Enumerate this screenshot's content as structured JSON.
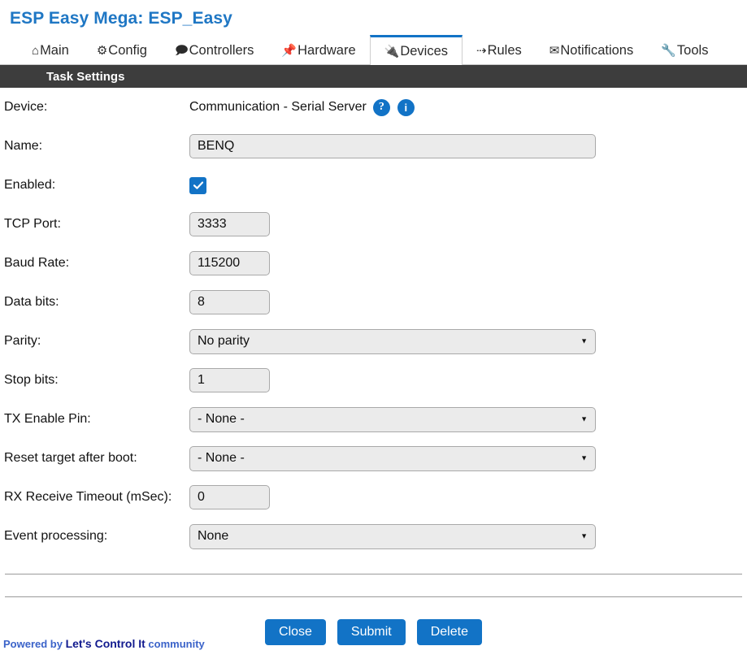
{
  "header": {
    "title": "ESP Easy Mega: ESP_Easy"
  },
  "tabs": [
    {
      "label": "Main",
      "icon": "home-icon",
      "glyph": "⌂",
      "active": false
    },
    {
      "label": "Config",
      "icon": "gear-icon",
      "glyph": "⚙",
      "active": false
    },
    {
      "label": "Controllers",
      "icon": "speech-bubble-icon",
      "glyph": "🗩",
      "active": false
    },
    {
      "label": "Hardware",
      "icon": "pushpin-icon",
      "glyph": "📌",
      "active": false
    },
    {
      "label": "Devices",
      "icon": "plug-icon",
      "glyph": "🔌",
      "active": true
    },
    {
      "label": "Rules",
      "icon": "arrow-branch-icon",
      "glyph": "⇢",
      "active": false
    },
    {
      "label": "Notifications",
      "icon": "envelope-icon",
      "glyph": "✉",
      "active": false
    },
    {
      "label": "Tools",
      "icon": "wrench-icon",
      "glyph": "🔧",
      "active": false
    }
  ],
  "section": {
    "title": "Task Settings"
  },
  "form": {
    "device": {
      "label": "Device:",
      "value": "Communication - Serial Server",
      "help_icon": "?",
      "info_icon": "i"
    },
    "name": {
      "label": "Name:",
      "value": "BENQ"
    },
    "enabled": {
      "label": "Enabled:",
      "checked": true
    },
    "tcp_port": {
      "label": "TCP Port:",
      "value": "3333"
    },
    "baud_rate": {
      "label": "Baud Rate:",
      "value": "115200"
    },
    "data_bits": {
      "label": "Data bits:",
      "value": "8"
    },
    "parity": {
      "label": "Parity:",
      "value": "No parity"
    },
    "stop_bits": {
      "label": "Stop bits:",
      "value": "1"
    },
    "tx_enable_pin": {
      "label": "TX Enable Pin:",
      "value": "- None -"
    },
    "reset_target_after_boot": {
      "label": "Reset target after boot:",
      "value": "- None -"
    },
    "rx_receive_timeout": {
      "label": "RX Receive Timeout (mSec):",
      "value": "0"
    },
    "event_processing": {
      "label": "Event processing:",
      "value": "None"
    }
  },
  "buttons": {
    "close": "Close",
    "submit": "Submit",
    "delete": "Delete"
  },
  "footer": {
    "prefix": "Powered by ",
    "brand": "Let's Control It",
    "suffix": " community"
  }
}
